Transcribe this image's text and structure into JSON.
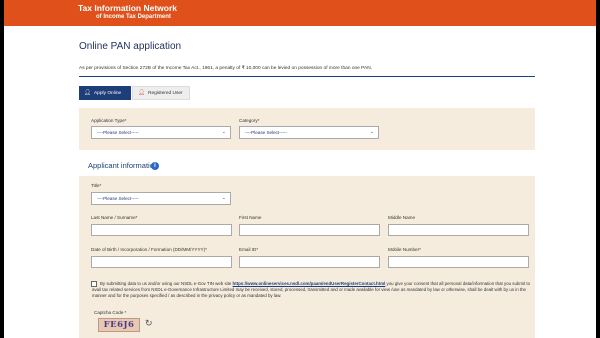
{
  "header": {
    "brand_line1": "Tax Information Network",
    "brand_line2": "of Income Tax Department",
    "bar_color": "#e0501a"
  },
  "page": {
    "title": "Online PAN application",
    "notice": "As per provisions of Section 272B of the Income Tax Act., 1961, a penalty of ₹ 10,000 can be levied on possession of more than one PAN."
  },
  "tabs": [
    {
      "label": "Apply Online",
      "icon": "user-add-icon",
      "active": true
    },
    {
      "label": "Registered User",
      "icon": "user-icon",
      "active": false
    }
  ],
  "form": {
    "application_type": {
      "label": "Application Type*",
      "value": "----Please Select-----"
    },
    "category": {
      "label": "Category*",
      "value": "----Please Select-----"
    },
    "applicant_heading": "Applicant information",
    "title_field": {
      "label": "Title*",
      "value": "----Please Select-----"
    },
    "last_name": {
      "label": "Last Name / Surname*",
      "value": ""
    },
    "first_name": {
      "label": "First Name",
      "value": ""
    },
    "middle_name": {
      "label": "Middle Name",
      "value": ""
    },
    "dob": {
      "label": "Date of Birth / Incorporation / Formation (DD/MM/YYYY)*",
      "value": ""
    },
    "email": {
      "label": "Email ID*",
      "value": ""
    },
    "mobile": {
      "label": "Mobile Number*",
      "value": ""
    },
    "consent_prefix": "By submitting data to us and/or using our NSDL e-Gov TIN web site ",
    "consent_link": "https://www.onlineservices.nsdl.com/paam/endUserRegisterContact.html",
    "consent_suffix": " you give your consent that all personal data/information that you submit to avail tax related services from NSDL e-Governance Infrastructure Limited may be received, stored, processed, transmitted and or made available for view /use as mandated by law or otherwise, shall be dealt with by us in the manner and for the purposes specified / as described in the privacy policy or as mandated by law.",
    "captcha_label": "Captcha Code *",
    "captcha_value": "FE6J6"
  }
}
